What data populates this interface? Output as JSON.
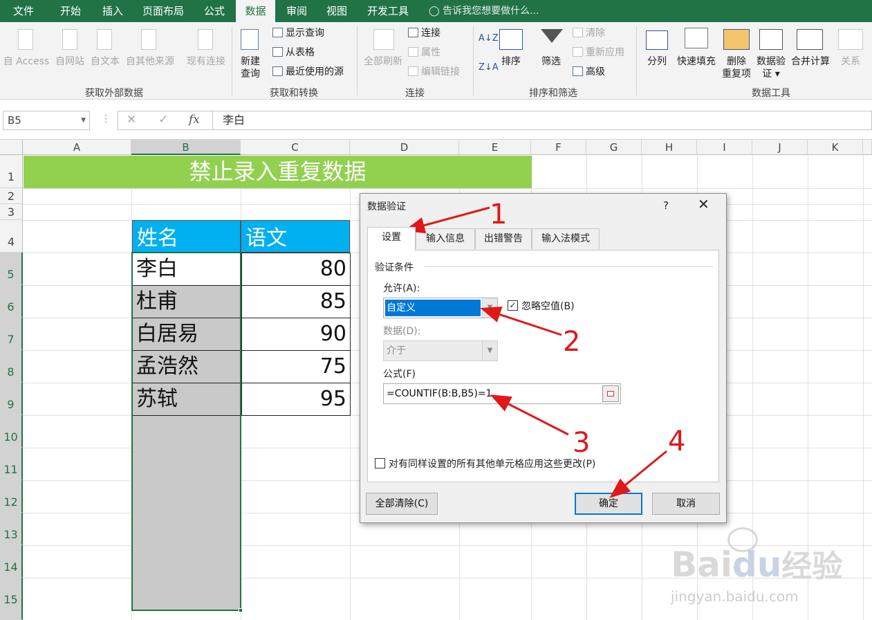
{
  "tabs": [
    "文件",
    "开始",
    "插入",
    "页面布局",
    "公式",
    "数据",
    "审阅",
    "视图",
    "开发工具"
  ],
  "active_tab": "数据",
  "tell_me": "告诉我您想要做什么...",
  "ribbon": {
    "ext_data": {
      "access": "自 Access",
      "web": "自网站",
      "text": "自文本",
      "other": "自其他来源",
      "existing": "现有连接",
      "label": "获取外部数据"
    },
    "transform": {
      "new_query_1": "新建",
      "new_query_2": "查询",
      "show_query": "显示查询",
      "from_table": "从表格",
      "recent": "最近使用的源",
      "label": "获取和转换"
    },
    "connections": {
      "refresh_all": "全部刷新",
      "connections": "连接",
      "properties": "属性",
      "edit_links": "编辑链接",
      "label": "连接"
    },
    "sort_filter": {
      "sort": "排序",
      "filter": "筛选",
      "clear": "清除",
      "reapply": "重新应用",
      "advanced": "高级",
      "label": "排序和筛选"
    },
    "data_tools": {
      "text_to_cols": "分列",
      "flash_fill": "快速填充",
      "remove_dup_1": "删除",
      "remove_dup_2": "重复项",
      "validation_1": "数据验",
      "validation_2": "证",
      "consolidate": "合并计算",
      "relations": "关系",
      "label": "数据工具"
    }
  },
  "formula_bar": {
    "name_box": "B5",
    "formula": "李白",
    "cancel": "✕",
    "enter": "✓",
    "fx": "fx"
  },
  "grid": {
    "columns": [
      "A",
      "B",
      "C",
      "D",
      "E",
      "F",
      "G",
      "H",
      "I",
      "J",
      "K"
    ],
    "rows": [
      "1",
      "2",
      "3",
      "4",
      "5",
      "6",
      "7",
      "8",
      "9",
      "10",
      "11",
      "12",
      "13",
      "14",
      "15"
    ],
    "title": "禁止录入重复数据",
    "headers": {
      "name": "姓名",
      "chinese": "语文"
    },
    "names": [
      "李白",
      "杜甫",
      "白居易",
      "孟浩然",
      "苏轼"
    ],
    "scores": [
      "80",
      "85",
      "90",
      "75",
      "95"
    ]
  },
  "dialog": {
    "title": "数据验证",
    "help": "?",
    "close": "✕",
    "tabs": [
      "设置",
      "输入信息",
      "出错警告",
      "输入法模式"
    ],
    "section": "验证条件",
    "allow_label": "允许(A):",
    "allow_value": "自定义",
    "ignore_blank": "忽略空值(B)",
    "data_label": "数据(D):",
    "data_value": "介于",
    "formula_label": "公式(F)",
    "formula_value": "=COUNTIF(B:B,B5)=1",
    "apply_all": "对有同样设置的所有其他单元格应用这些更改(P)",
    "clear_all": "全部清除(C)",
    "ok": "确定",
    "cancel": "取消"
  },
  "annotations": [
    "1",
    "2",
    "3",
    "4"
  ],
  "watermark": {
    "brand": "Bai",
    "brand2": "du",
    "cn": "经验",
    "url": "jingyan.baidu.com"
  },
  "colors": {
    "excel_green": "#217346",
    "title_fill": "#92d050",
    "header_fill": "#00b0f0",
    "selection_gray": "#c9c9c9",
    "arrow_red": "#e01818",
    "ok_blue": "#0078d7"
  }
}
